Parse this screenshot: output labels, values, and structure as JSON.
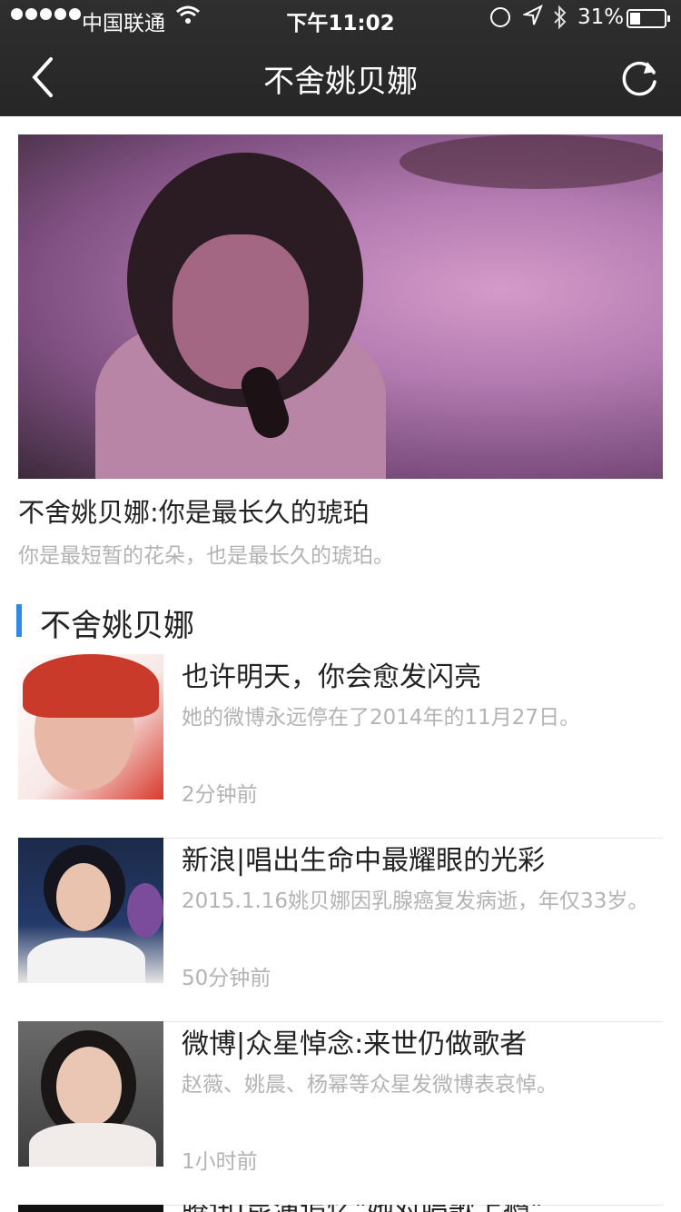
{
  "status_bar": {
    "carrier": "中国联通",
    "time": "下午11:02",
    "battery": "31%"
  },
  "nav": {
    "title": "不舍姚贝娜"
  },
  "feature": {
    "title": "不舍姚贝娜:你是最长久的琥珀",
    "subtitle": "你是最短暂的花朵，也是最长久的琥珀。"
  },
  "section": {
    "title": "不舍姚贝娜",
    "accent_color": "#2d8ae6"
  },
  "articles": [
    {
      "title": "也许明天，你会愈发闪亮",
      "summary": "她的微博永远停在了2014年的11月27日。",
      "time": "2分钟前"
    },
    {
      "title": "新浪|唱出生命中最耀眼的光彩",
      "summary": "2015.1.16姚贝娜因乳腺癌复发病逝，年仅33岁。",
      "time": "50分钟前"
    },
    {
      "title": "微博|众星悼念:来世仍做歌者",
      "summary": "赵薇、姚晨、杨幂等众星发微博表哀悼。",
      "time": "1小时前"
    },
    {
      "title": "腾讯|昆演追忆\"她对唱歌上瘾\""
    }
  ],
  "icons": {
    "back": "chevron-left-icon",
    "refresh": "refresh-icon",
    "wifi": "wifi-icon",
    "location": "location-arrow-icon",
    "bluetooth": "bluetooth-icon",
    "lock": "rotation-lock-icon"
  }
}
